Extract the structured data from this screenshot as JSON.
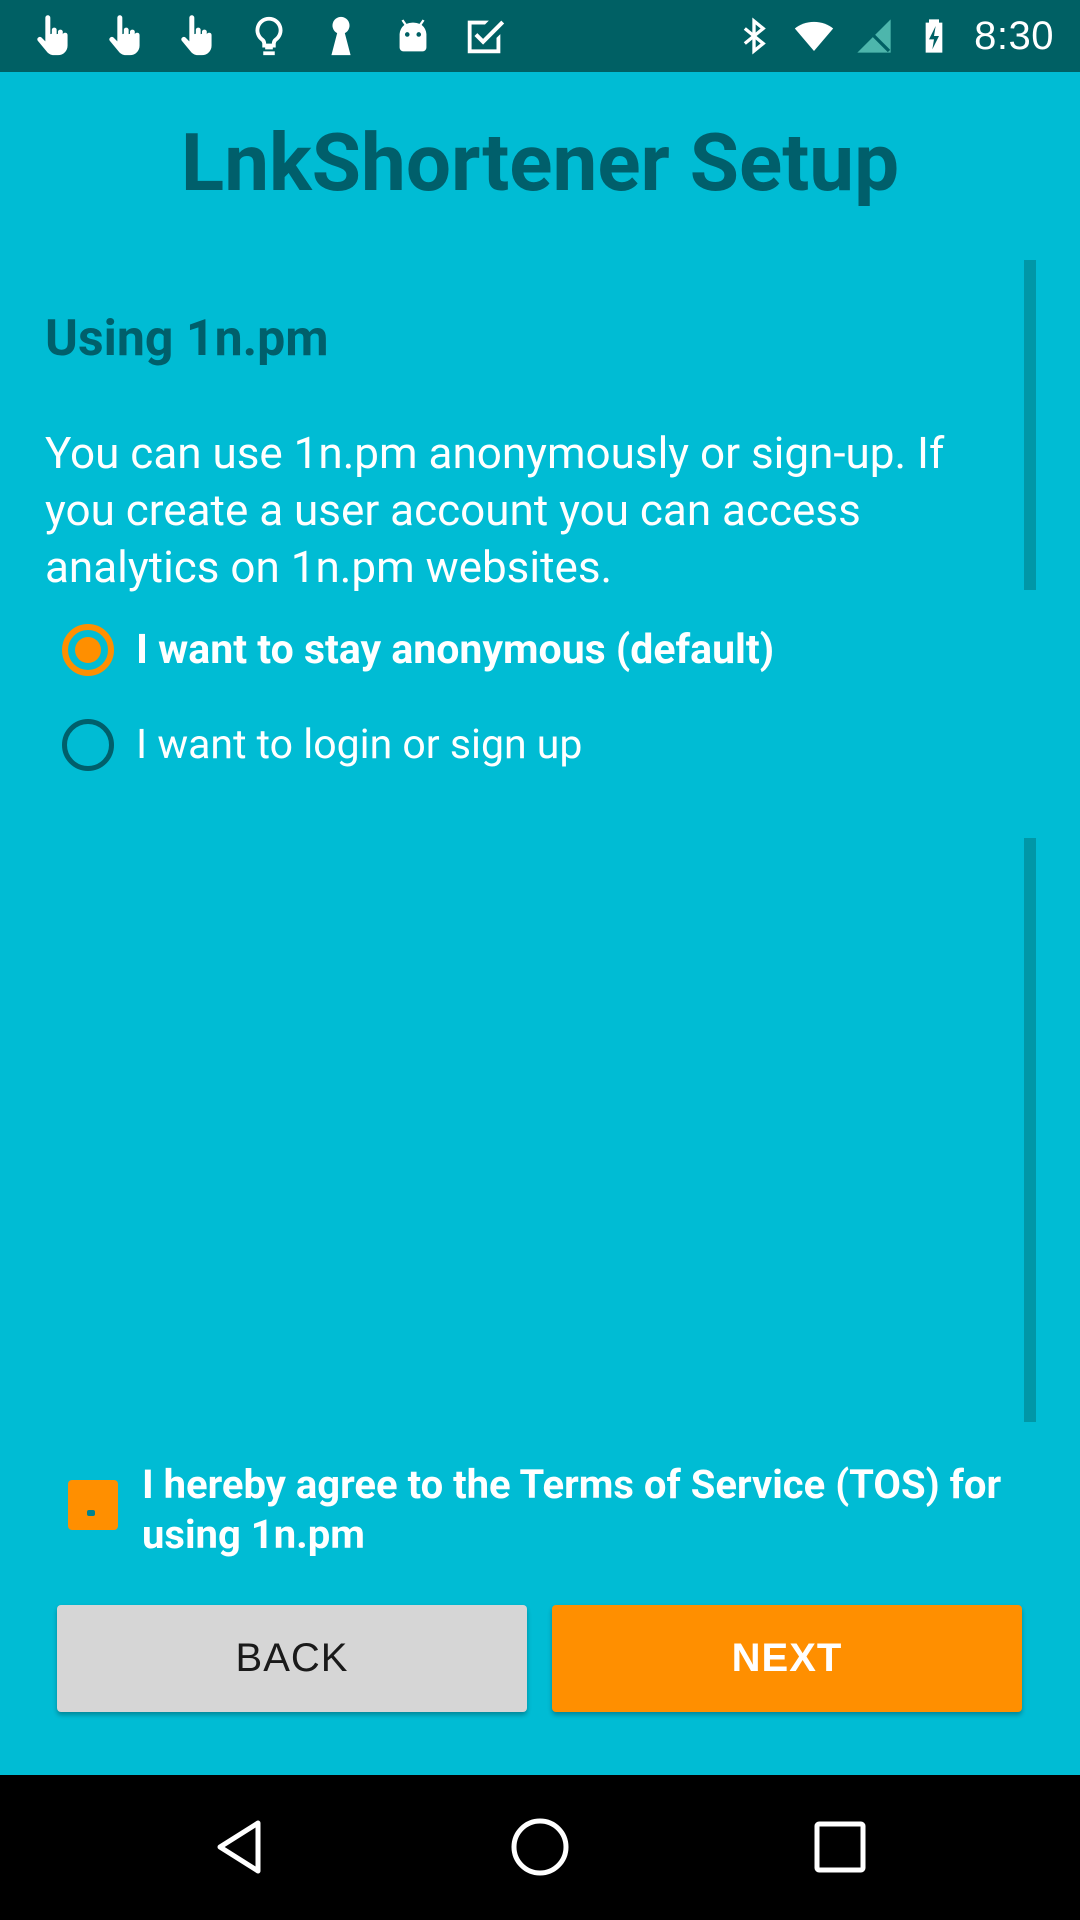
{
  "status_bar": {
    "time": "8:30",
    "left_icons": [
      "hand-pointer-icon",
      "hand-pointer-icon",
      "hand-pointer-icon",
      "lightbulb-icon",
      "keyhole-icon",
      "android-icon",
      "check-box-icon"
    ],
    "right_icons": [
      "bluetooth-icon",
      "wifi-icon",
      "no-signal-icon",
      "battery-charging-icon"
    ]
  },
  "title": "LnkShortener Setup",
  "section": {
    "heading": "Using 1n.pm",
    "description": "You can use 1n.pm anonymously or sign-up. If you create a user account you can access analytics on 1n.pm websites."
  },
  "radio_options": [
    {
      "label": "I want to stay anonymous (default)",
      "selected": true
    },
    {
      "label": "I want to login or sign up",
      "selected": false
    }
  ],
  "tos_checkbox": {
    "label": "I hereby agree to the Terms of Service (TOS) for using 1n.pm",
    "checked": true
  },
  "buttons": {
    "back_label": "BACK",
    "next_label": "NEXT"
  },
  "colors": {
    "background": "#00bcd4",
    "status_bar": "#006064",
    "accent": "#ff8f00",
    "heading_text": "#005f6b"
  }
}
